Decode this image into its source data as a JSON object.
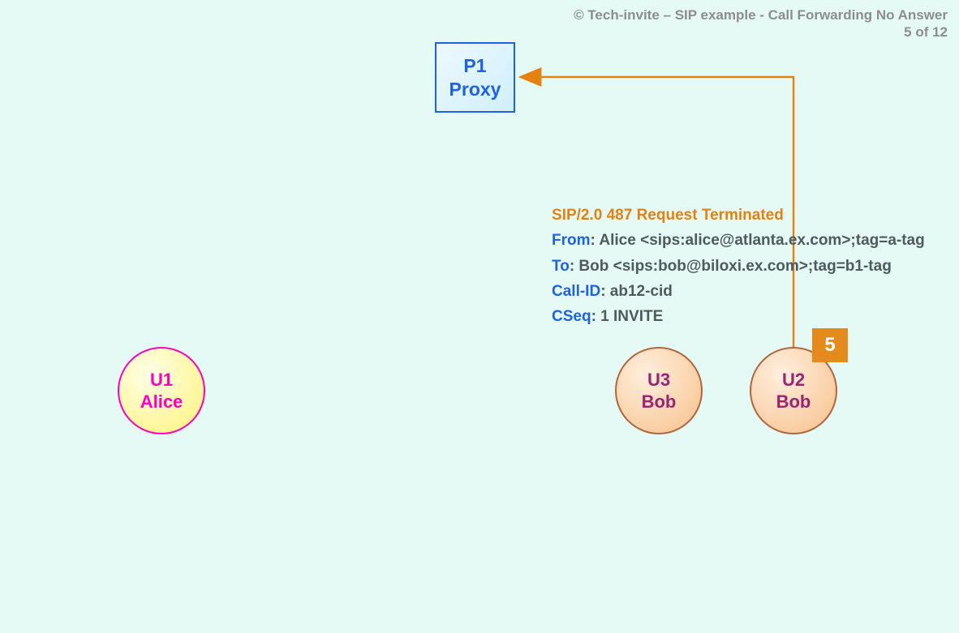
{
  "header": {
    "line1": "© Tech-invite – SIP example - Call Forwarding No Answer",
    "line2": "5 of 12"
  },
  "proxy": {
    "id": "P1",
    "role": "Proxy"
  },
  "nodes": {
    "alice": {
      "id": "U1",
      "name": "Alice"
    },
    "u3": {
      "id": "U3",
      "name": "Bob"
    },
    "u2": {
      "id": "U2",
      "name": "Bob"
    }
  },
  "step": {
    "number": "5"
  },
  "sip": {
    "status_line": "SIP/2.0 487 Request Terminated",
    "headers": {
      "from": {
        "label": "From",
        "value": ": Alice <sips:alice@atlanta.ex.com>;tag=a-tag"
      },
      "to": {
        "label": "To",
        "value": ": Bob <sips:bob@biloxi.ex.com>;tag=b1-tag"
      },
      "callid": {
        "label": "Call-ID",
        "value": ": ab12-cid"
      },
      "cseq": {
        "label": "CSeq",
        "value": ": 1 INVITE"
      }
    }
  },
  "arrow": {
    "color": "#e58111"
  }
}
